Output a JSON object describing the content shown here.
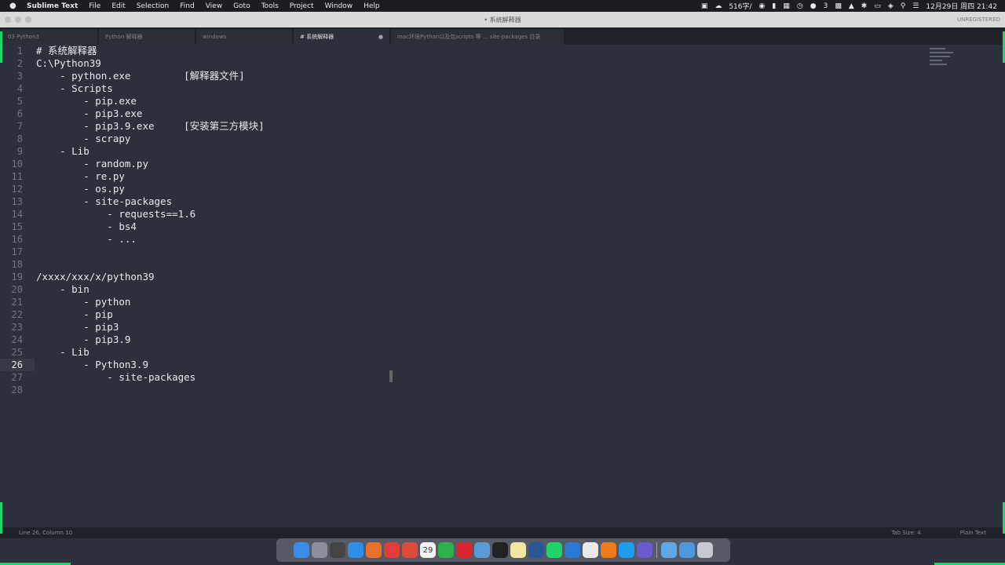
{
  "menubar": {
    "app": "Sublime Text",
    "items": [
      "File",
      "Edit",
      "Selection",
      "Find",
      "View",
      "Goto",
      "Tools",
      "Project",
      "Window",
      "Help"
    ],
    "right": {
      "net_speed": "516字/",
      "wechat_count": "3",
      "datetime": "12月29日 周四 21:42"
    }
  },
  "titlebar": {
    "title": "• 系统解释器",
    "unregistered": "UNREGISTERED"
  },
  "tabs": [
    {
      "label": "03 Python3",
      "active": false
    },
    {
      "label": "Python 解释器",
      "active": false
    },
    {
      "label": "windows",
      "active": false
    },
    {
      "label": "# 系统解释器",
      "active": true
    },
    {
      "label": "mac环境Python以及包scripts 等 ... site-packages 目录",
      "active": false
    }
  ],
  "editor": {
    "current_line": "26",
    "lines": [
      {
        "n": "1",
        "text": "# 系统解释器"
      },
      {
        "n": "2",
        "text": "C:\\Python39"
      },
      {
        "n": "3",
        "text": "    - python.exe         [解释器文件]"
      },
      {
        "n": "4",
        "text": "    - Scripts"
      },
      {
        "n": "5",
        "text": "        - pip.exe"
      },
      {
        "n": "6",
        "text": "        - pip3.exe"
      },
      {
        "n": "7",
        "text": "        - pip3.9.exe     [安装第三方模块]"
      },
      {
        "n": "8",
        "text": "        - scrapy"
      },
      {
        "n": "9",
        "text": "    - Lib"
      },
      {
        "n": "10",
        "text": "        - random.py"
      },
      {
        "n": "11",
        "text": "        - re.py"
      },
      {
        "n": "12",
        "text": "        - os.py"
      },
      {
        "n": "13",
        "text": "        - site-packages"
      },
      {
        "n": "14",
        "text": "            - requests==1.6"
      },
      {
        "n": "15",
        "text": "            - bs4"
      },
      {
        "n": "16",
        "text": "            - ..."
      },
      {
        "n": "17",
        "text": ""
      },
      {
        "n": "18",
        "text": ""
      },
      {
        "n": "19",
        "text": "/xxxx/xxx/x/python39"
      },
      {
        "n": "20",
        "text": "    - bin"
      },
      {
        "n": "21",
        "text": "        - python"
      },
      {
        "n": "22",
        "text": "        - pip"
      },
      {
        "n": "23",
        "text": "        - pip3"
      },
      {
        "n": "24",
        "text": "        - pip3.9"
      },
      {
        "n": "25",
        "text": "    - Lib"
      },
      {
        "n": "26",
        "text": "        - Python3.9"
      },
      {
        "n": "27",
        "text": "            - site-packages"
      },
      {
        "n": "28",
        "text": ""
      }
    ]
  },
  "statusbar": {
    "position": "Line 26, Column 10",
    "tab_size": "Tab Size: 4",
    "syntax": "Plain Text"
  },
  "dock": {
    "icons": [
      "finder-icon",
      "launchpad-icon",
      "mission-control-icon",
      "safari-icon",
      "firefox-icon",
      "todo-icon",
      "chrome-icon",
      "calendar-icon",
      "wechat-icon",
      "netease-music-icon",
      "preview-icon",
      "terminal-icon",
      "notes-icon",
      "word-icon",
      "pycharm-icon",
      "vscode-icon",
      "textedit-icon",
      "sublime-icon",
      "qq-icon",
      "screen-recorder-icon",
      "folder-icon",
      "downloads-folder-icon",
      "trash-icon"
    ],
    "calendar_day": "29"
  }
}
